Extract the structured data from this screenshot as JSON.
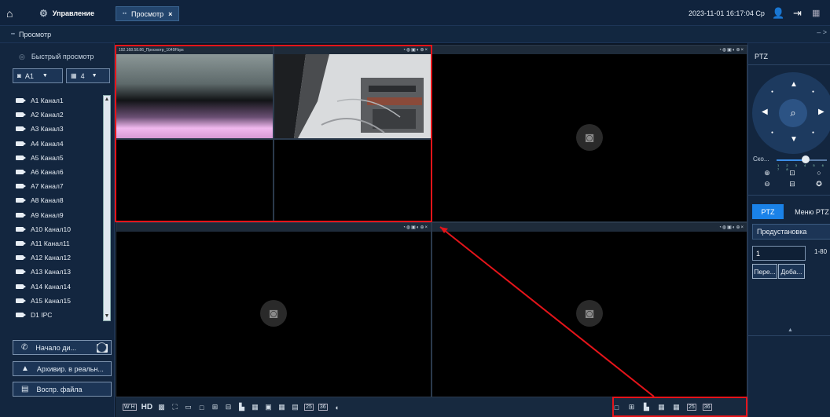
{
  "topbar": {
    "management_label": "Управление",
    "tab_label": "Просмотр",
    "datetime": "2023-11-01 16:17:04 Ср"
  },
  "subbar": {
    "title": "Просмотр"
  },
  "sidebar": {
    "quick_view_label": "Быстрый просмотр",
    "stream_select": "A1",
    "split_select": "4",
    "channels": [
      "A1 Канал1",
      "A2 Канал2",
      "A3 Канал3",
      "A4 Канал4",
      "A5 Канал5",
      "A6 Канал6",
      "A7 Канал7",
      "A8 Канал8",
      "A9 Канал9",
      "A10 Канал10",
      "A11 Канал11",
      "A12 Канал12",
      "A13 Канал13",
      "A14 Канал14",
      "A15 Канал15",
      "D1 IPC"
    ],
    "intercom_label": "Начало ди...",
    "archive_label": "Архивир. в реальн...",
    "playback_label": "Воспр. файла"
  },
  "grid": {
    "camera_title": "192.168.58.86_Просмотр_1049Fbps"
  },
  "bottombar": {
    "hd_label": "HD",
    "split_25": "25",
    "split_36": "36"
  },
  "ptz": {
    "title": "PTZ",
    "speed_label": "Ско...",
    "speed_ticks": "1 2 3 4 5 6 7 8",
    "speed_level": 5,
    "speed_max": 8,
    "tab_ptz": "PTZ",
    "tab_menu": "Меню PTZ",
    "preset_dropdown": "Предустановка",
    "preset_value": "1",
    "preset_range": "1-80",
    "goto_button": "Пере...",
    "add_button": "Доба..."
  },
  "colors": {
    "accent": "#1a82e8",
    "highlight": "#e5141a",
    "panel": "#13263f"
  }
}
